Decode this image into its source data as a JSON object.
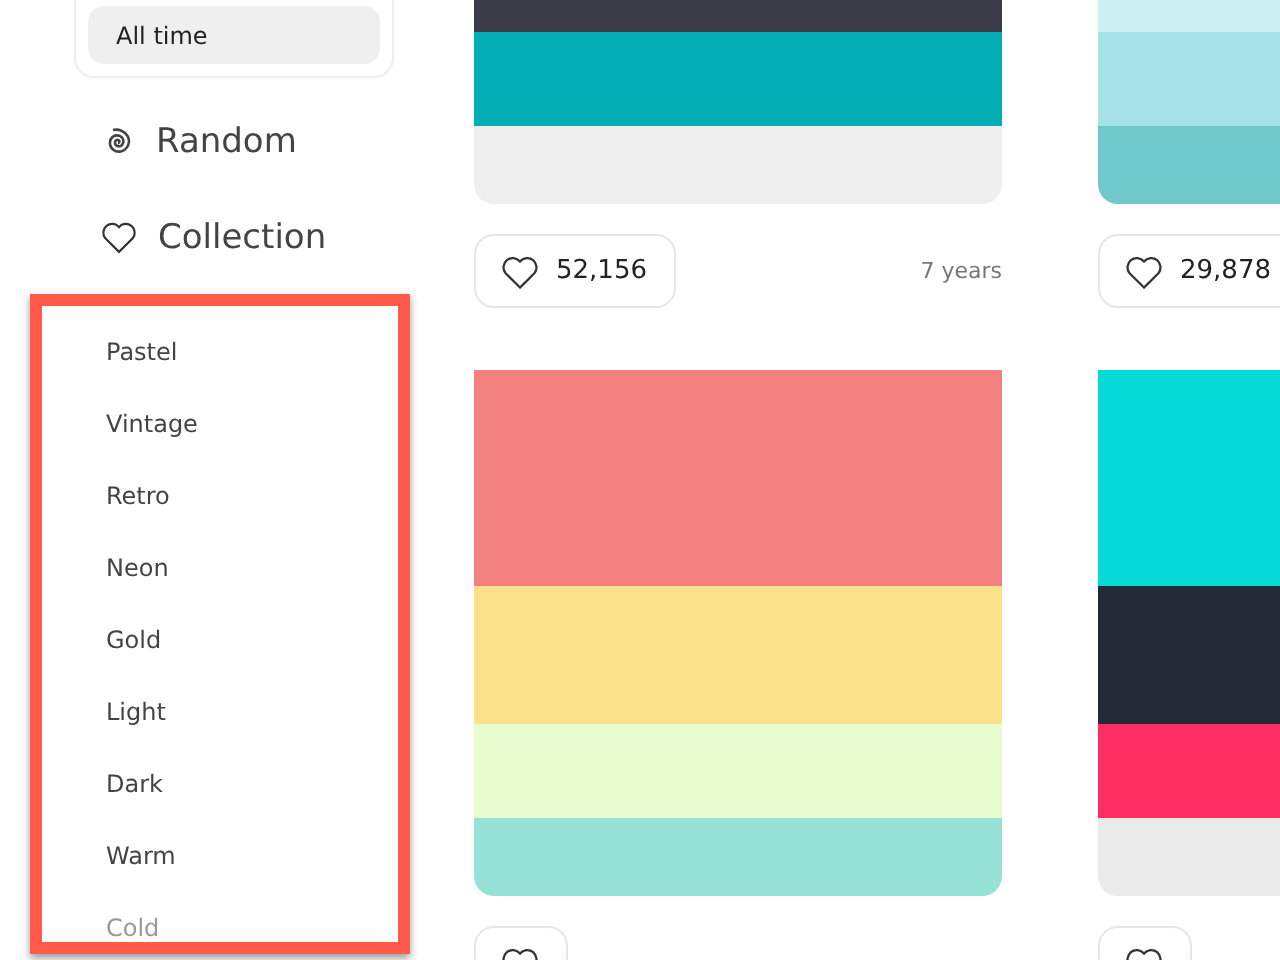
{
  "sidebar": {
    "time_filter": {
      "label": "All time",
      "selected": true
    },
    "nav": [
      {
        "kind": "spiral",
        "label": "Random"
      },
      {
        "kind": "heart",
        "label": "Collection"
      }
    ],
    "tags": [
      "Pastel",
      "Vintage",
      "Retro",
      "Neon",
      "Gold",
      "Light",
      "Dark",
      "Warm",
      "Cold"
    ]
  },
  "palettes": [
    {
      "swatches": [
        {
          "color": "#3a3d47"
        },
        {
          "color": "#02adb5"
        },
        {
          "color": "#eeeeee"
        }
      ],
      "likes": "52,156",
      "age": "7 years"
    },
    {
      "swatches": [
        {
          "color": "#cdf0f3"
        },
        {
          "color": "#a8e2e9"
        },
        {
          "color": "#6fc8cb"
        }
      ],
      "likes": "29,878"
    },
    {
      "swatches": [
        {
          "color": "#f3817f"
        },
        {
          "color": "#fae18a"
        },
        {
          "color": "#e8fccf"
        },
        {
          "color": "#97e2d6"
        }
      ]
    },
    {
      "swatches": [
        {
          "color": "#06dad6"
        },
        {
          "color": "#242a35"
        },
        {
          "color": "#fe2d62"
        },
        {
          "color": "#eaeaea"
        }
      ]
    }
  ]
}
